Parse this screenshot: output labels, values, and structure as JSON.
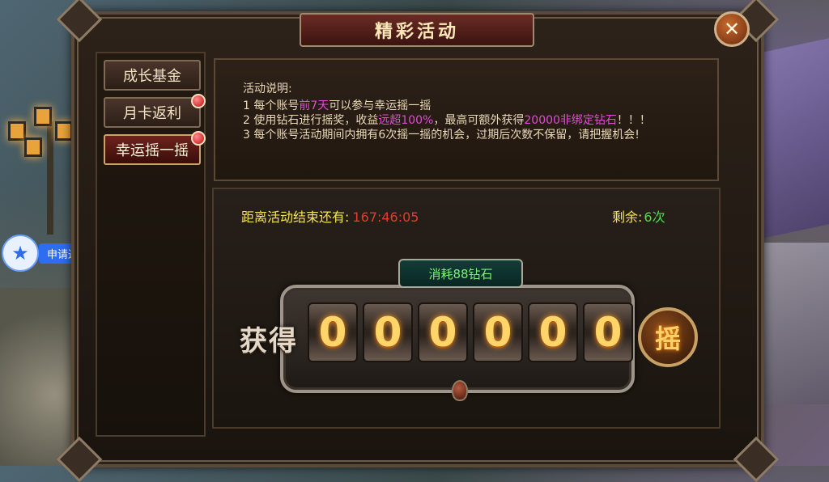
{
  "panel": {
    "title": "精彩活动",
    "close_icon": "close-x-icon"
  },
  "tabs": [
    {
      "label": "成长基金",
      "active": false,
      "badge": false
    },
    {
      "label": "月卡返利",
      "active": false,
      "badge": true
    },
    {
      "label": "幸运摇一摇",
      "active": true,
      "badge": true
    }
  ],
  "description": {
    "heading": "活动说明:",
    "line1_a": "1 每个账号",
    "line1_hl": "前7天",
    "line1_b": "可以参与幸运摇一摇",
    "line2_a": "2 使用钻石进行摇奖，收益",
    "line2_hl1": "远超100%",
    "line2_b": "，最高可额外获得",
    "line2_hl2": "20000非绑定钻石",
    "line2_c": "！！！",
    "line3": "3 每个账号活动期间内拥有6次摇一摇的机会，过期后次数不保留，请把握机会!"
  },
  "lottery": {
    "countdown_label": "距离活动结束还有:",
    "countdown_value": "167:46:05",
    "remain_label": "剩余:",
    "remain_value": "6次",
    "cost_label": "消耗88钻石",
    "gain_label": "获得",
    "digits": [
      "0",
      "0",
      "0",
      "0",
      "0",
      "0"
    ],
    "shake_label": "摇"
  },
  "side_widget": {
    "icon": "star-gamepad-icon",
    "label": "申请返利"
  },
  "colors": {
    "accent_yellow": "#f6e54a",
    "timer_red": "#e83a2e",
    "remain_green": "#44e04a",
    "highlight_magenta": "#e04bd6"
  }
}
